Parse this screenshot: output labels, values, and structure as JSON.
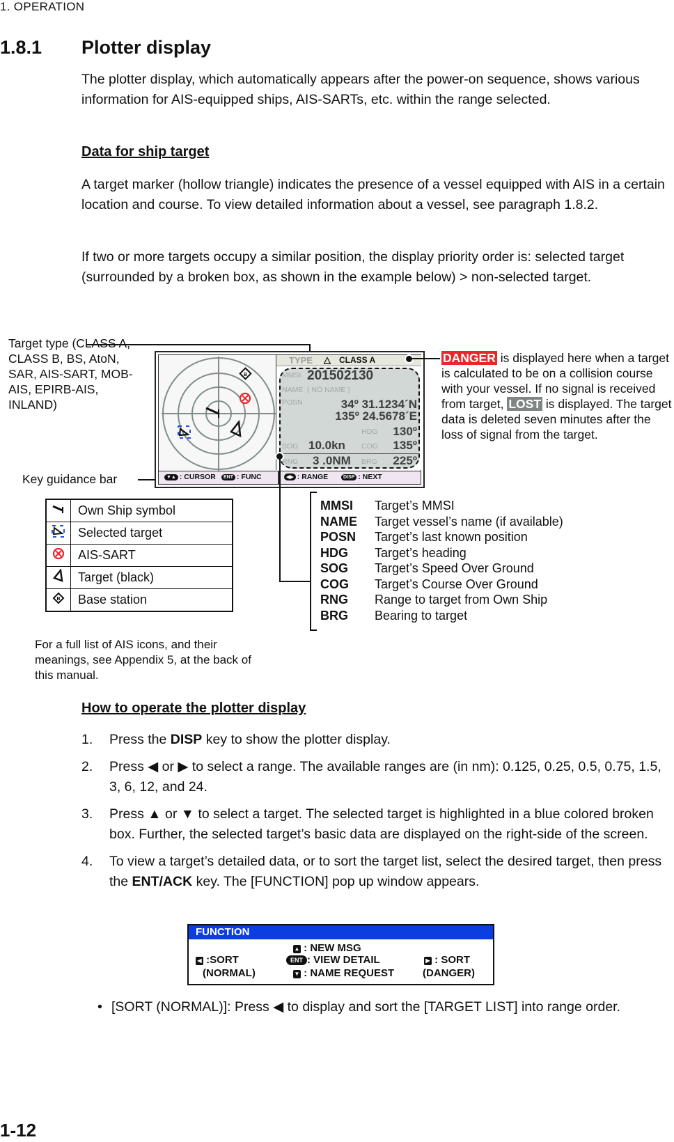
{
  "running_head": "1.  OPERATION",
  "section": {
    "number": "1.8.1",
    "title": "Plotter display"
  },
  "intro": "The plotter display, which automatically appears after the power-on sequence, shows various information for AIS-equipped ships, AIS-SARTs, etc. within the range selected.",
  "data_heading": "Data for ship target",
  "data_para1": "A target marker (hollow triangle) indicates the presence of a vessel equipped with AIS in a certain location and course. To view detailed information about a vessel, see paragraph 1.8.2.",
  "data_para2": "If two or more targets occupy a similar position, the display priority order is: selected target (surrounded by a broken box, as shown in the example below) > non-selected target.",
  "figure": {
    "target_type_callout": "Target type (CLASS A, CLASS B, BS, AtoN, SAR, AIS-SART, MOB-AIS, EPIRB-AIS, INLAND)",
    "key_guidance_callout": "Key guidance bar",
    "danger_chip": "DANGER",
    "danger_text": " is displayed here when a target is calculated to be on a collision course with your vessel. If no signal is received from target, ",
    "lost_chip": "LOST",
    "lost_text": " is displayed. The target data is deleted seven minutes after the loss of signal from the target.",
    "screen": {
      "type_label": "TYPE",
      "type_value": "CLASS A",
      "mmsi_label": "MMSI",
      "mmsi": "201502130",
      "name_label": "NAME",
      "name": "{ NO  NAME }",
      "posn_label": "POSN",
      "lat": "34º 31.1234´N",
      "lon": "135º 24.5678´E",
      "hdg_label": "HDG",
      "hdg": "130º",
      "sog_label": "SOG",
      "sog": "10.0kn",
      "cog_label": "COG",
      "cog": "135º",
      "rng_label": "RNG",
      "rng": "3 .0NM",
      "brg_label": "BRG",
      "brg": "225º",
      "keys": [
        {
          "key": "▼▲",
          "label": ": CURSOR"
        },
        {
          "key": "ENT",
          "label": ": FUNC"
        },
        {
          "key": "◀▶",
          "label": ": RANGE"
        },
        {
          "key": "DISP",
          "label": ": NEXT"
        }
      ]
    },
    "legend": [
      {
        "icon": "own-ship-icon",
        "label": "Own Ship symbol"
      },
      {
        "icon": "selected-target-icon",
        "label": "Selected target"
      },
      {
        "icon": "ais-sart-icon",
        "label": "AIS-SART"
      },
      {
        "icon": "target-icon",
        "label": "Target (black)"
      },
      {
        "icon": "base-station-icon",
        "label": "Base station"
      }
    ],
    "legend_note": "For a full list of AIS icons, and their meanings, see Appendix 5, at the back of this manual.",
    "fields": [
      {
        "key": "MMSI",
        "desc": "Target’s MMSI"
      },
      {
        "key": "NAME",
        "desc": "Target vessel’s name (if available)"
      },
      {
        "key": "POSN",
        "desc": "Target’s last known position"
      },
      {
        "key": "HDG",
        "desc": "Target’s heading"
      },
      {
        "key": "SOG",
        "desc": "Target’s Speed Over Ground"
      },
      {
        "key": "COG",
        "desc": "Target’s Course Over Ground"
      },
      {
        "key": "RNG",
        "desc": "Range to target from Own Ship"
      },
      {
        "key": "BRG",
        "desc": "Bearing to target"
      }
    ],
    "colors": {
      "danger": "#e8262d",
      "lost": "#7f8785",
      "selected": "#1f4fe0",
      "function_header": "#0a3ee0"
    }
  },
  "operate_heading": "How to operate the plotter display",
  "steps": [
    {
      "n": "1.",
      "pre": "Press the ",
      "bold": "DISP",
      "post": " key to show the plotter display."
    },
    {
      "n": "2.",
      "pre": "Press ◀ or ▶ to select a range. The available ranges are (in nm): 0.125, 0.25, 0.5, 0.75, 1.5, 3, 6, 12, and 24.",
      "bold": "",
      "post": ""
    },
    {
      "n": "3.",
      "pre": "Press ▲ or ▼ to select a target. The selected target is highlighted in a blue colored broken box. Further, the selected target’s basic data are displayed on the right-side of the screen.",
      "bold": "",
      "post": ""
    },
    {
      "n": "4.",
      "pre": "To view a target’s detailed data, or to sort the target list, select the desired target, then press the ",
      "bold": "ENT/ACK",
      "post": " key. The [FUNCTION] pop up window appears."
    }
  ],
  "function_window": {
    "title": "FUNCTION",
    "left": {
      "key": "◀",
      "line1": ":SORT",
      "line2": "(NORMAL)"
    },
    "center": [
      {
        "key": "▲",
        "label": ": NEW MSG"
      },
      {
        "key": "ENT",
        "label": ": VIEW DETAIL"
      },
      {
        "key": "▼",
        "label": ": NAME REQUEST"
      }
    ],
    "right": {
      "key": "▶",
      "line1": ": SORT",
      "line2": "(DANGER)"
    }
  },
  "bullet": "[SORT (NORMAL)]: Press ◀ to display and sort the [TARGET LIST] into range order.",
  "page_number": "1-12"
}
